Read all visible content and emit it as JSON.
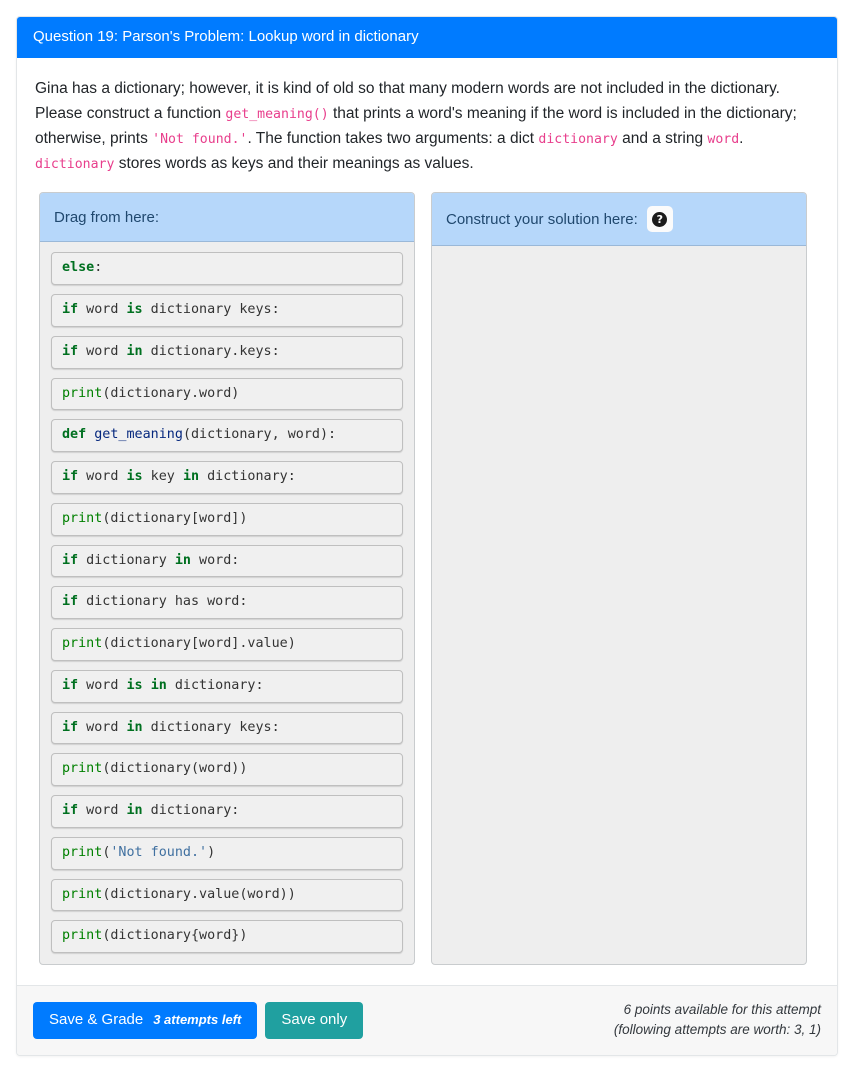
{
  "header": {
    "title": "Question 19: Parson's Problem: Lookup word in dictionary"
  },
  "description": {
    "parts": [
      {
        "type": "text",
        "text": "Gina has a dictionary; however, it is kind of old so that many modern words are not included in the dictionary. Please construct a function "
      },
      {
        "type": "code",
        "text": "get_meaning()"
      },
      {
        "type": "text",
        "text": " that prints a word's meaning if the word is included in the dictionary; otherwise, prints "
      },
      {
        "type": "code",
        "text": "'Not found.'"
      },
      {
        "type": "text",
        "text": ". The function takes two arguments: a dict "
      },
      {
        "type": "code",
        "text": "dictionary"
      },
      {
        "type": "text",
        "text": " and a string "
      },
      {
        "type": "code",
        "text": "word"
      },
      {
        "type": "text",
        "text": ". "
      },
      {
        "type": "code",
        "text": "dictionary"
      },
      {
        "type": "text",
        "text": " stores words as keys and their meanings as values."
      }
    ]
  },
  "source_panel": {
    "title": "Drag from here:",
    "blocks": [
      {
        "text": "else:",
        "tokens": [
          {
            "t": "else",
            "c": "kw"
          },
          {
            "t": ":",
            "c": "pl"
          }
        ]
      },
      {
        "text": "if word is dictionary keys:",
        "tokens": [
          {
            "t": "if",
            "c": "kw"
          },
          {
            "t": " word ",
            "c": "pl"
          },
          {
            "t": "is",
            "c": "kw"
          },
          {
            "t": " dictionary keys:",
            "c": "pl"
          }
        ]
      },
      {
        "text": "if word in dictionary.keys:",
        "tokens": [
          {
            "t": "if",
            "c": "kw"
          },
          {
            "t": " word ",
            "c": "pl"
          },
          {
            "t": "in",
            "c": "kw"
          },
          {
            "t": " dictionary.keys:",
            "c": "pl"
          }
        ]
      },
      {
        "text": "print(dictionary.word)",
        "tokens": [
          {
            "t": "print",
            "c": "bi"
          },
          {
            "t": "(dictionary.word)",
            "c": "pl"
          }
        ]
      },
      {
        "text": "def get_meaning(dictionary, word):",
        "tokens": [
          {
            "t": "def",
            "c": "kw"
          },
          {
            "t": " ",
            "c": "pl"
          },
          {
            "t": "get_meaning",
            "c": "fn"
          },
          {
            "t": "(dictionary, word):",
            "c": "pl"
          }
        ]
      },
      {
        "text": "if word is key in dictionary:",
        "tokens": [
          {
            "t": "if",
            "c": "kw"
          },
          {
            "t": " word ",
            "c": "pl"
          },
          {
            "t": "is",
            "c": "kw"
          },
          {
            "t": " key ",
            "c": "pl"
          },
          {
            "t": "in",
            "c": "kw"
          },
          {
            "t": " dictionary:",
            "c": "pl"
          }
        ]
      },
      {
        "text": "print(dictionary[word])",
        "tokens": [
          {
            "t": "print",
            "c": "bi"
          },
          {
            "t": "(dictionary[word])",
            "c": "pl"
          }
        ]
      },
      {
        "text": "if dictionary in word:",
        "tokens": [
          {
            "t": "if",
            "c": "kw"
          },
          {
            "t": " dictionary ",
            "c": "pl"
          },
          {
            "t": "in",
            "c": "kw"
          },
          {
            "t": " word:",
            "c": "pl"
          }
        ]
      },
      {
        "text": "if dictionary has word:",
        "tokens": [
          {
            "t": "if",
            "c": "kw"
          },
          {
            "t": " dictionary has word:",
            "c": "pl"
          }
        ]
      },
      {
        "text": "print(dictionary[word].value)",
        "tokens": [
          {
            "t": "print",
            "c": "bi"
          },
          {
            "t": "(dictionary[word].value)",
            "c": "pl"
          }
        ]
      },
      {
        "text": "if word is in dictionary:",
        "tokens": [
          {
            "t": "if",
            "c": "kw"
          },
          {
            "t": " word ",
            "c": "pl"
          },
          {
            "t": "is",
            "c": "kw"
          },
          {
            "t": " ",
            "c": "pl"
          },
          {
            "t": "in",
            "c": "kw"
          },
          {
            "t": " dictionary:",
            "c": "pl"
          }
        ]
      },
      {
        "text": "if word in dictionary keys:",
        "tokens": [
          {
            "t": "if",
            "c": "kw"
          },
          {
            "t": " word ",
            "c": "pl"
          },
          {
            "t": "in",
            "c": "kw"
          },
          {
            "t": " dictionary keys:",
            "c": "pl"
          }
        ]
      },
      {
        "text": "print(dictionary(word))",
        "tokens": [
          {
            "t": "print",
            "c": "bi"
          },
          {
            "t": "(dictionary(word))",
            "c": "pl"
          }
        ]
      },
      {
        "text": "if word in dictionary:",
        "tokens": [
          {
            "t": "if",
            "c": "kw"
          },
          {
            "t": " word ",
            "c": "pl"
          },
          {
            "t": "in",
            "c": "kw"
          },
          {
            "t": " dictionary:",
            "c": "pl"
          }
        ]
      },
      {
        "text": "print('Not found.')",
        "tokens": [
          {
            "t": "print",
            "c": "bi"
          },
          {
            "t": "(",
            "c": "pl"
          },
          {
            "t": "'Not found.'",
            "c": "str"
          },
          {
            "t": ")",
            "c": "pl"
          }
        ]
      },
      {
        "text": "print(dictionary.value(word))",
        "tokens": [
          {
            "t": "print",
            "c": "bi"
          },
          {
            "t": "(dictionary.value(word))",
            "c": "pl"
          }
        ]
      },
      {
        "text": "print(dictionary{word})",
        "tokens": [
          {
            "t": "print",
            "c": "bi"
          },
          {
            "t": "(dictionary{word})",
            "c": "pl"
          }
        ]
      }
    ]
  },
  "target_panel": {
    "title": "Construct your solution here:",
    "help_icon": "question-mark-icon",
    "help_glyph": "?",
    "blocks": []
  },
  "footer": {
    "save_grade_label": "Save & Grade",
    "attempts_label": "3 attempts left",
    "save_only_label": "Save only",
    "points_line1": "6 points available for this attempt",
    "points_line2": "(following attempts are worth: 3, 1)"
  },
  "colors": {
    "header_bg": "#007bff",
    "panel_head_bg": "#b6d7fa",
    "panel_body_bg": "#eeeeee",
    "primary_button": "#007bff",
    "teal_button": "#20a0a0",
    "inline_code": "#e83e8c",
    "keyword": "#007020",
    "function": "#06287e",
    "builtin": "#008000",
    "string": "#4070a0"
  }
}
